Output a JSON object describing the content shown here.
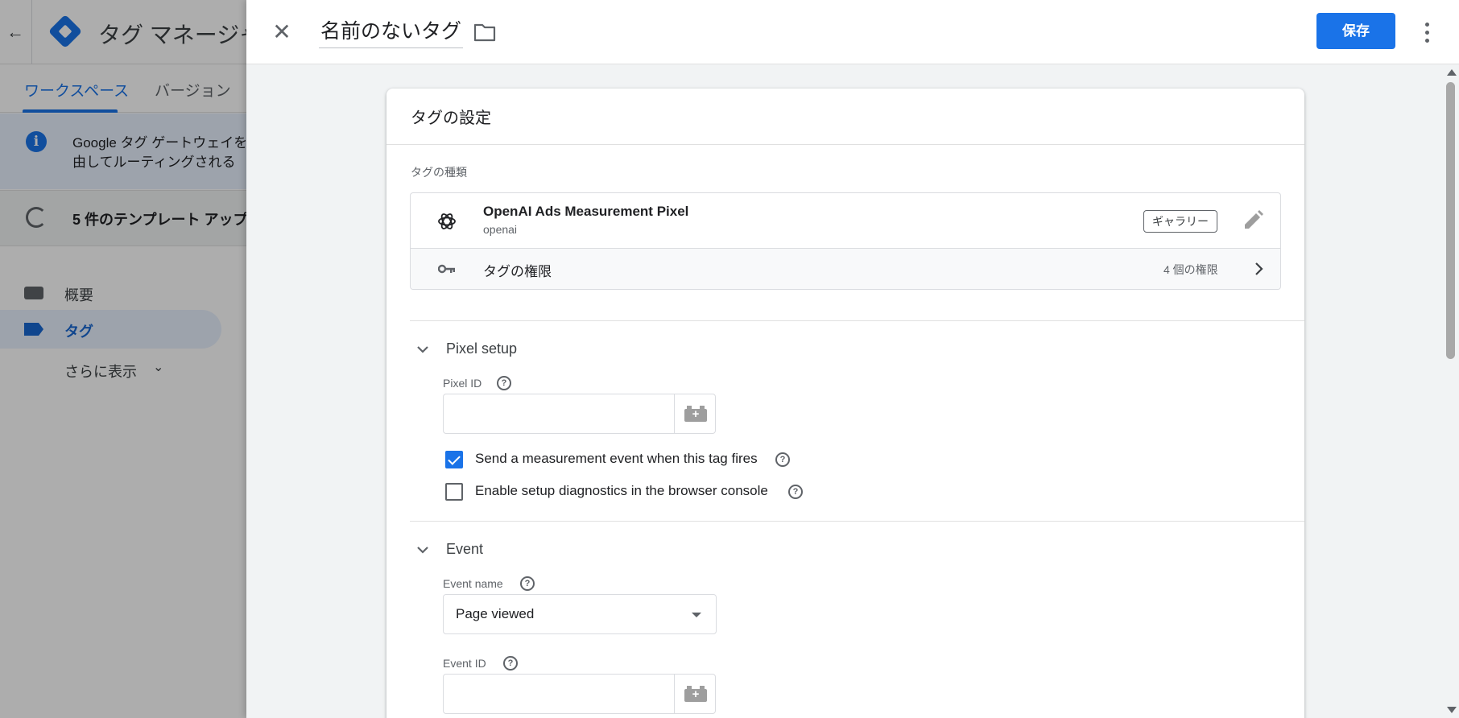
{
  "background": {
    "title": "タグ マネージャー",
    "tabs": [
      {
        "label": "ワークスペース",
        "active": true
      },
      {
        "label": "バージョン",
        "active": false
      }
    ],
    "banner_gateway": {
      "line1": "Google タグ ゲートウェイを",
      "line2": "由してルーティングされる"
    },
    "banner_templates": {
      "text": "5 件のテンプレート アップ"
    },
    "nav": [
      {
        "label": "概要",
        "icon": "folder-icon",
        "active": false
      },
      {
        "label": "タグ",
        "icon": "label-icon",
        "active": true
      }
    ],
    "more_label": "さらに表示"
  },
  "editor": {
    "tag_name": "名前のないタグ",
    "save_label": "保存",
    "card_title": "タグの設定",
    "tag_type_label": "タグの種類",
    "template": {
      "name": "OpenAI Ads Measurement Pixel",
      "vendor": "openai",
      "badge": "ギャラリー",
      "icon": "openai-icon"
    },
    "permissions": {
      "label": "タグの権限",
      "count": "4 個の権限"
    },
    "sections": {
      "pixel_setup": {
        "title": "Pixel setup",
        "pixel_id_label": "Pixel ID",
        "pixel_id_value": "",
        "checkbox_measure": {
          "label": "Send a measurement event when this tag fires",
          "checked": true
        },
        "checkbox_diag": {
          "label": "Enable setup diagnostics in the browser console",
          "checked": false
        }
      },
      "event": {
        "title": "Event",
        "event_name_label": "Event name",
        "event_name_value": "Page viewed",
        "event_id_label": "Event ID",
        "event_id_value": ""
      }
    }
  },
  "colors": {
    "primary": "#1a73e8",
    "text": "#202124",
    "muted": "#5f6368",
    "surface": "#f1f3f4"
  }
}
